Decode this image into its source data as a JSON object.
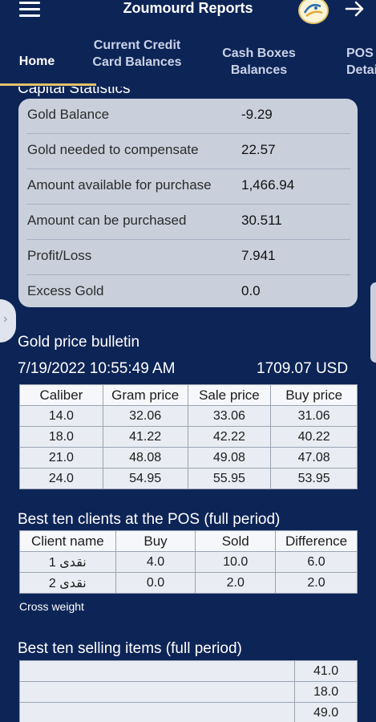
{
  "header": {
    "title": "Zoumourd Reports",
    "menu_icon": "hamburger-menu-icon",
    "logo_icon": "zoumourd-logo",
    "forward_icon": "arrow-right-icon"
  },
  "tabs": [
    {
      "label": "Home",
      "active": true
    },
    {
      "label": "Current Credit Card Balances",
      "active": false
    },
    {
      "label": "Cash Boxes Balances",
      "active": false
    },
    {
      "label": "POS Details",
      "active": false
    }
  ],
  "capital": {
    "title": "Capital Statistics",
    "rows": [
      {
        "label": "Gold Balance",
        "value": "-9.29"
      },
      {
        "label": "Gold needed to compensate",
        "value": "22.57"
      },
      {
        "label": "Amount available for purchase",
        "value": "1,466.94"
      },
      {
        "label": "Amount can be purchased",
        "value": "30.511"
      },
      {
        "label": "Profit/Loss",
        "value": "7.941"
      },
      {
        "label": "Excess Gold",
        "value": "0.0"
      }
    ]
  },
  "bulletin": {
    "title": "Gold price bulletin",
    "date": "7/19/2022 10:55:49 AM",
    "price": "1709.07 USD",
    "columns": [
      "Caliber",
      "Gram price",
      "Sale price",
      "Buy price"
    ],
    "rows": [
      [
        "14.0",
        "32.06",
        "33.06",
        "31.06"
      ],
      [
        "18.0",
        "41.22",
        "42.22",
        "40.22"
      ],
      [
        "21.0",
        "48.08",
        "49.08",
        "47.08"
      ],
      [
        "24.0",
        "54.95",
        "55.95",
        "53.95"
      ]
    ]
  },
  "clients": {
    "title": "Best ten clients at the POS (full period)",
    "columns": [
      "Client name",
      "Buy",
      "Sold",
      "Difference"
    ],
    "rows": [
      [
        "نقدى 1",
        "4.0",
        "10.0",
        "6.0"
      ],
      [
        "نقدى 2",
        "0.0",
        "2.0",
        "2.0"
      ]
    ],
    "note": "Cross weight"
  },
  "items": {
    "title": "Best ten selling items (full period)",
    "rows": [
      [
        "",
        "41.0"
      ],
      [
        "",
        "18.0"
      ],
      [
        "",
        "49.0"
      ]
    ]
  }
}
